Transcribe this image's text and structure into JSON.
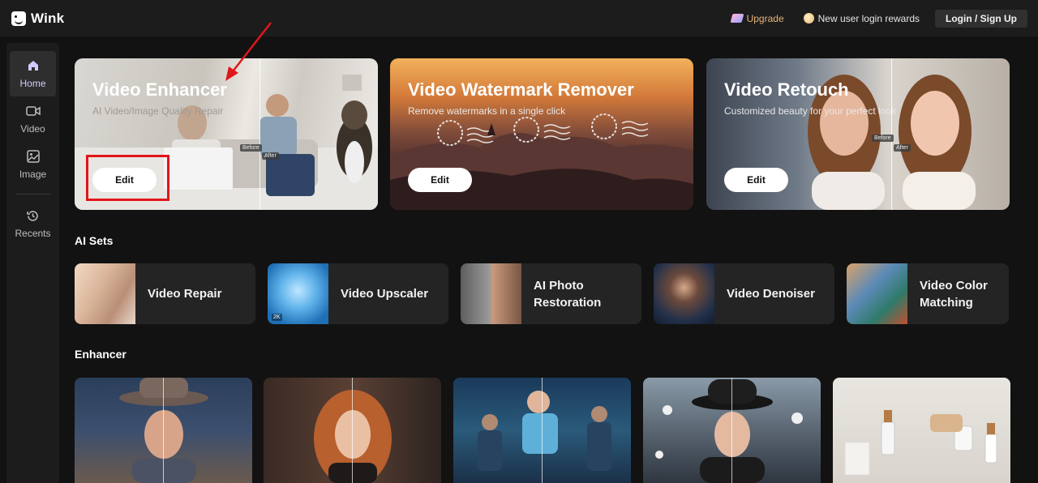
{
  "app": {
    "name": "Wink"
  },
  "topbar": {
    "upgrade_label": "Upgrade",
    "rewards_label": "New user login rewards",
    "login_label": "Login / Sign Up"
  },
  "sidebar": {
    "items": [
      {
        "label": "Home",
        "icon": "home-icon",
        "active": true
      },
      {
        "label": "Video",
        "icon": "video-camera-icon"
      },
      {
        "label": "Image",
        "icon": "image-icon"
      },
      {
        "label": "Recents",
        "icon": "history-icon"
      }
    ]
  },
  "hero_cards": [
    {
      "title": "Video Enhancer",
      "subtitle": "AI Video/Image Quality Repair",
      "button": "Edit",
      "before": "Before",
      "after": "After"
    },
    {
      "title": "Video Watermark Remover",
      "subtitle": "Remove watermarks in a single click",
      "button": "Edit"
    },
    {
      "title": "Video Retouch",
      "subtitle": "Customized beauty for your perfect look",
      "button": "Edit",
      "before": "Before",
      "after": "After"
    }
  ],
  "ai_sets": {
    "title": "AI Sets",
    "items": [
      {
        "label": "Video Repair"
      },
      {
        "label": "Video Upscaler",
        "badge": "2K"
      },
      {
        "label": "AI Photo Restoration"
      },
      {
        "label": "Video Denoiser"
      },
      {
        "label": "Video Color Matching"
      }
    ]
  },
  "enhancer": {
    "title": "Enhancer"
  },
  "colors": {
    "accent": "#d6c9ff",
    "upgrade": "#e6b27a",
    "highlight_box": "#e0161b",
    "annotation_arrow": "#e0161b"
  }
}
